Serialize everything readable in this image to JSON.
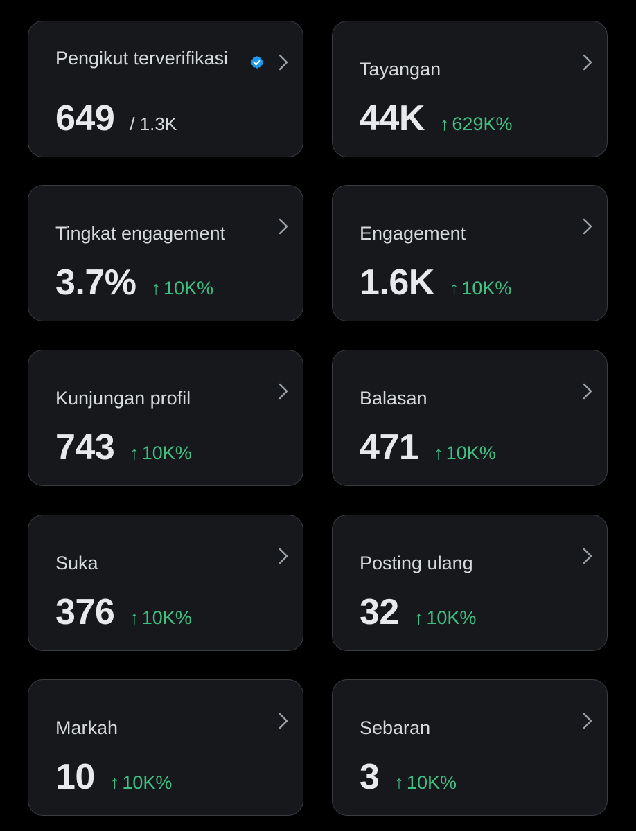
{
  "colors": {
    "background": "#000000",
    "card_background": "#16181c",
    "card_border": "#3a3d42",
    "positive": "#3fbf82",
    "verified": "#1d9bf0"
  },
  "icons": {
    "chevron": "chevron-right-icon",
    "verified": "verified-badge-icon",
    "arrow": "arrow-up-icon"
  },
  "arrow_glyph": "↑",
  "cards": [
    {
      "label": "Pengikut terverifikasi",
      "value": "649",
      "sub_value": "/ 1.3K"
    },
    {
      "label": "Tayangan",
      "value": "44K",
      "change": "629K%"
    },
    {
      "label": "Tingkat engagement",
      "value": "3.7%",
      "change": "10K%"
    },
    {
      "label": "Engagement",
      "value": "1.6K",
      "change": "10K%"
    },
    {
      "label": "Kunjungan profil",
      "value": "743",
      "change": "10K%"
    },
    {
      "label": "Balasan",
      "value": "471",
      "change": "10K%"
    },
    {
      "label": "Suka",
      "value": "376",
      "change": "10K%"
    },
    {
      "label": "Posting ulang",
      "value": "32",
      "change": "10K%"
    },
    {
      "label": "Markah",
      "value": "10",
      "change": "10K%"
    },
    {
      "label": "Sebaran",
      "value": "3",
      "change": "10K%"
    }
  ]
}
